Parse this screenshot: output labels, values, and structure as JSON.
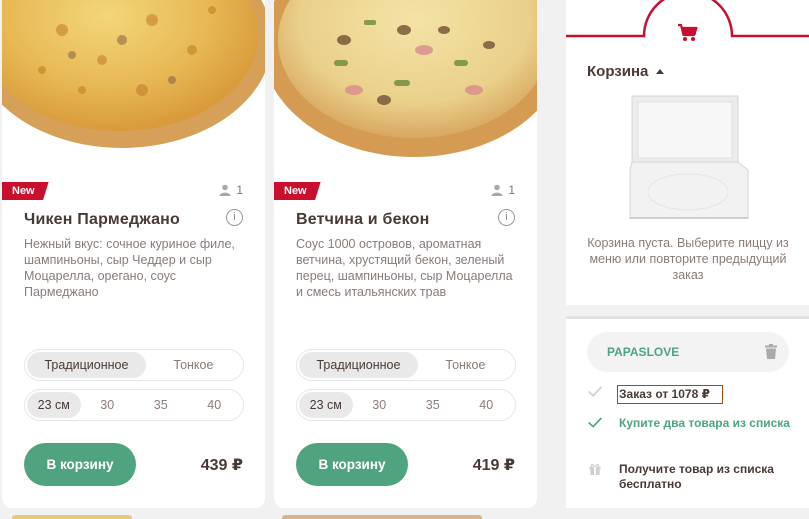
{
  "products": [
    {
      "badge": "New",
      "persons": "1",
      "title": "Чикен Пармеджано",
      "description": "Нежный вкус: сочное куриное филе, шампиньоны, сыр Чеддер и сыр Моцарелла, орегано, соус Пармеджано",
      "dough_options": [
        "Традиционное",
        "Тонкое"
      ],
      "dough_selected": "Традиционное",
      "size_options": [
        "23 см",
        "30",
        "35",
        "40"
      ],
      "size_selected": "23 см",
      "add_label": "В корзину",
      "price": "439 ₽"
    },
    {
      "badge": "New",
      "persons": "1",
      "title": "Ветчина и бекон",
      "description": "Соус 1000 островов, ароматная ветчина, хрустящий бекон, зеленый перец, шампиньоны, сыр Моцарелла и смесь итальянских трав",
      "dough_options": [
        "Традиционное",
        "Тонкое"
      ],
      "dough_selected": "Традиционное",
      "size_options": [
        "23 см",
        "30",
        "35",
        "40"
      ],
      "size_selected": "23 см",
      "add_label": "В корзину",
      "price": "419 ₽"
    }
  ],
  "cart": {
    "title": "Корзина",
    "empty_text": "Корзина пуста. Выберите пиццу из меню или повторите предыдущий заказ"
  },
  "promo": {
    "code": "PAPASLOVE",
    "conditions": [
      {
        "text": "Заказ от 1078 ₽",
        "icon": "check-icon"
      },
      {
        "text": "Купите два товара из списка",
        "icon": "check-icon"
      },
      {
        "text": "Получите товар из списка бесплатно",
        "icon": "gift-icon"
      }
    ]
  },
  "colors": {
    "accent_red": "#c8102e",
    "green": "#4fa37f",
    "text_dark": "#4a3a35"
  }
}
